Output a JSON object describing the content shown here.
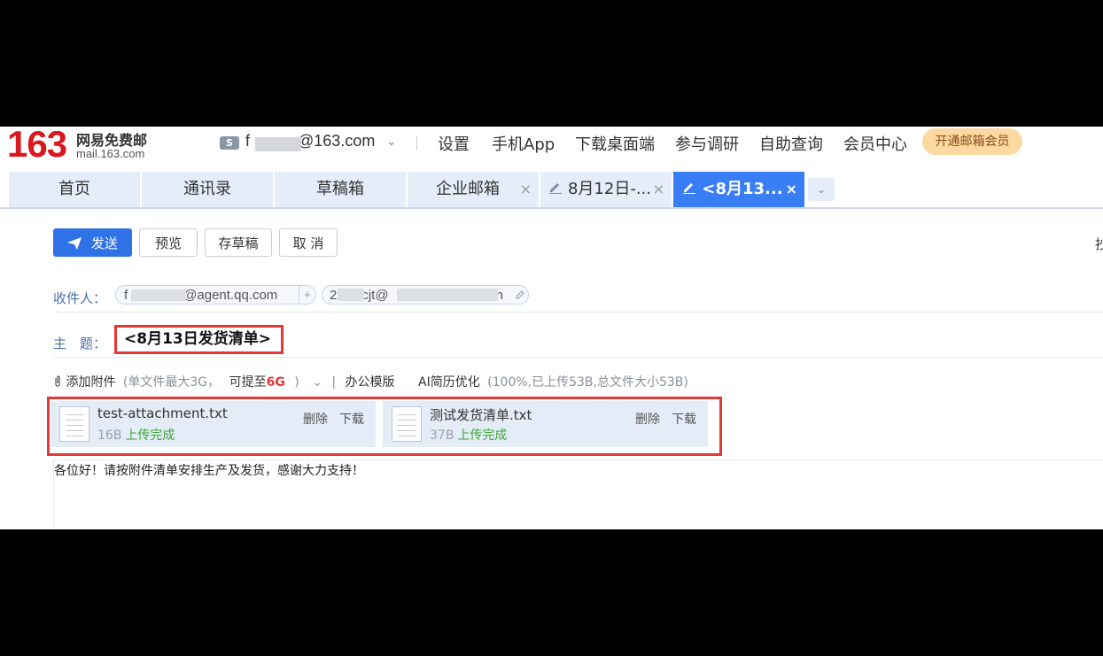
{
  "logo": {
    "number": "163",
    "name": "网易免费邮",
    "url": "mail.163.com"
  },
  "account": {
    "icon": "S",
    "email_prefix": "f",
    "email_suffix": "@163.com"
  },
  "nav": [
    "设置",
    "手机App",
    "下载桌面端",
    "参与调研",
    "自助查询",
    "会员中心"
  ],
  "vip_label": "开通邮箱会员",
  "tabs": [
    {
      "label": "首页"
    },
    {
      "label": "通讯录"
    },
    {
      "label": "草稿箱"
    },
    {
      "label": "企业邮箱"
    },
    {
      "label": "8月12日-..."
    },
    {
      "label": "<8月13..."
    }
  ],
  "toolbar": {
    "send": "发送",
    "preview": "预览",
    "save_draft": "存草稿",
    "cancel": "取 消"
  },
  "edge_char": "抄",
  "recipients": {
    "label": "收件人：",
    "chip1": {
      "prefix": "f",
      "suffix": "@agent.qq.com"
    },
    "chip2": {
      "prefix": "2",
      "mid": "cjt@",
      "end": "h"
    }
  },
  "subject": {
    "label": "主　题：",
    "value": "<8月13日发货清单>"
  },
  "attachment_bar": {
    "add": "添加附件",
    "limit_open": "(单文件最大3G，",
    "upgrade": "可提至",
    "upgrade_size": "6G",
    "limit_close": ")",
    "office": "办公模版",
    "ai": "AI简历优化",
    "summary": "(100%,已上传53B,总文件大小53B)"
  },
  "attachments": [
    {
      "name": "test-attachment.txt",
      "size": "16B",
      "status": "上传完成",
      "delete": "删除",
      "download": "下载"
    },
    {
      "name": "测试发货清单.txt",
      "size": "37B",
      "status": "上传完成",
      "delete": "删除",
      "download": "下载"
    }
  ],
  "body_text": "各位好！请按附件清单安排生产及发货，感谢大力支持！",
  "colors": {
    "accent": "#3a7ef5",
    "logo": "#d8171f",
    "highlight": "#e53935",
    "success": "#3aa935"
  }
}
